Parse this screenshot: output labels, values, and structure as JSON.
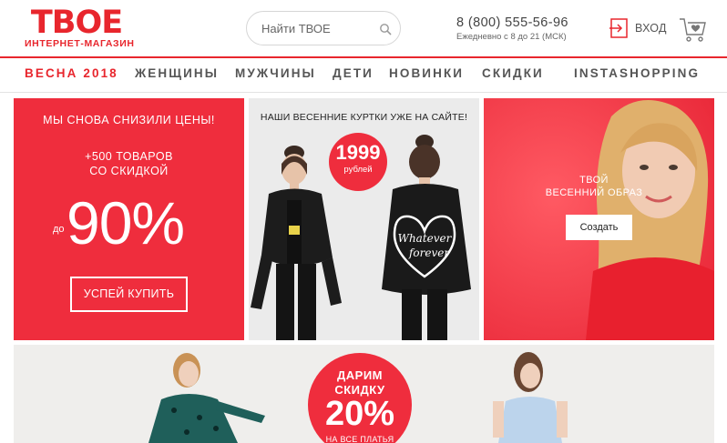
{
  "header": {
    "logo_word": "ТВОЕ",
    "logo_sub": "ИНТЕРНЕТ-МАГАЗИН",
    "search_placeholder": "Найти ТВОЕ",
    "phone": "8 (800) 555-56-96",
    "hours": "Ежедневно с 8 до 21 (МСК)",
    "login_label": "ВХОД",
    "icons": {
      "search": "search-icon",
      "login": "login-icon",
      "cart": "cart-icon"
    }
  },
  "nav": {
    "items": [
      "ВЕСНА 2018",
      "ЖЕНЩИНЫ",
      "МУЖЧИНЫ",
      "ДЕТИ",
      "НОВИНКИ",
      "СКИДКИ",
      "INSTASHOPPING"
    ],
    "active_index": 0
  },
  "banner_sale": {
    "headline": "МЫ СНОВА СНИЗИЛИ ЦЕНЫ!",
    "sub_line1": "+500 ТОВАРОВ",
    "sub_line2": "СО СКИДКОЙ",
    "prefix": "до",
    "big": "90%",
    "button": "УСПЕЙ КУПИТЬ"
  },
  "banner_jackets": {
    "headline": "НАШИ ВЕСЕННИЕ КУРТКИ УЖЕ НА САЙТЕ!",
    "price": "1999",
    "currency": "рублей",
    "jacket_print_line1": "Whatever",
    "jacket_print_line2": "forever"
  },
  "banner_look": {
    "line1": "ТВОЙ",
    "line2": "ВЕСЕННИЙ ОБРАЗ",
    "button": "Создать"
  },
  "banner_dress": {
    "line1": "ДАРИМ",
    "line2": "СКИДКУ",
    "big": "20%",
    "line3": "НА ВСЕ ПЛАТЬЯ"
  },
  "colors": {
    "brand_red": "#e8262d",
    "banner_red": "#ef2d3d",
    "nav_text": "#555555"
  }
}
